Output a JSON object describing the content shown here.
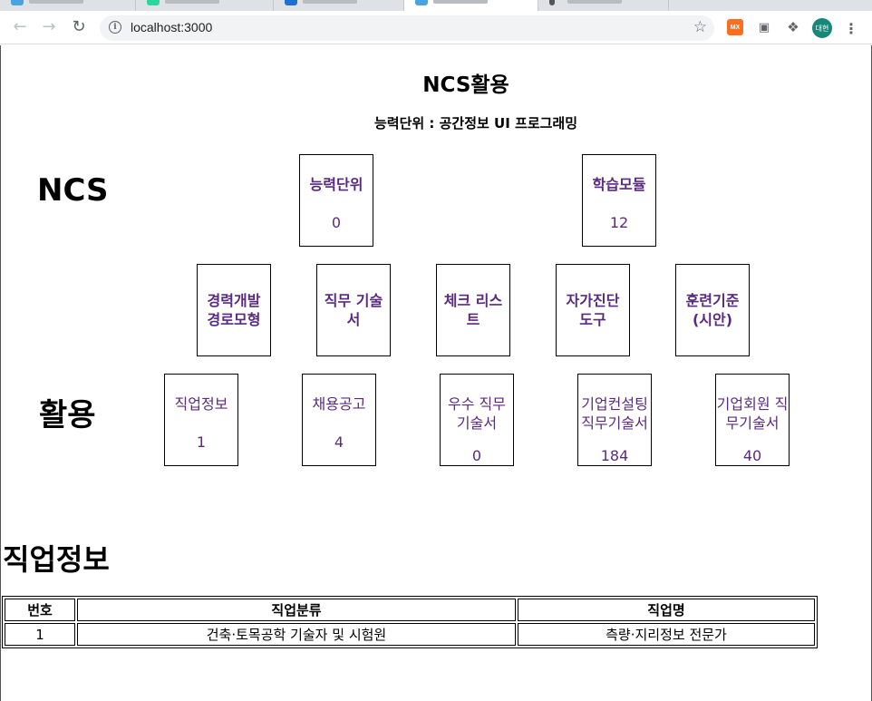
{
  "browser": {
    "url": "localhost:3000",
    "profile_initials": "대현",
    "extensions": [
      "mx-extension",
      "screen-icon",
      "puzzle-icon"
    ]
  },
  "page": {
    "title": "NCS활용",
    "subtitle": "능력단위 : 공간정보 UI 프로그래밍"
  },
  "labels": {
    "ncs": "NCS",
    "usage": "활용"
  },
  "ncs_cards": [
    {
      "label": "능력단위",
      "value": "0"
    },
    {
      "label": "학습모듈",
      "value": "12"
    }
  ],
  "ncs_links": [
    {
      "label": "경력개발 경로모형"
    },
    {
      "label": "직무 기술서"
    },
    {
      "label": "체크 리스트"
    },
    {
      "label": "자가진단 도구"
    },
    {
      "label": "훈련기준 (시안)"
    }
  ],
  "usage_cards": [
    {
      "label": "직업정보",
      "value": "1"
    },
    {
      "label": "채용공고",
      "value": "4"
    },
    {
      "label": "우수 직무 기술서",
      "value": "0"
    },
    {
      "label": "기업컨설팅 직무기술서",
      "value": "184"
    },
    {
      "label": "기업회원 직무기술서",
      "value": "40"
    }
  ],
  "section": {
    "heading": "직업정보"
  },
  "table": {
    "headers": [
      "번호",
      "직업분류",
      "직업명"
    ],
    "rows": [
      [
        "1",
        "건축·토목공학 기술자 및 시험원",
        "측량·지리정보 전문가"
      ]
    ]
  },
  "colors": {
    "card_text": "#5a2a80",
    "avatar_bg": "#17877a"
  }
}
